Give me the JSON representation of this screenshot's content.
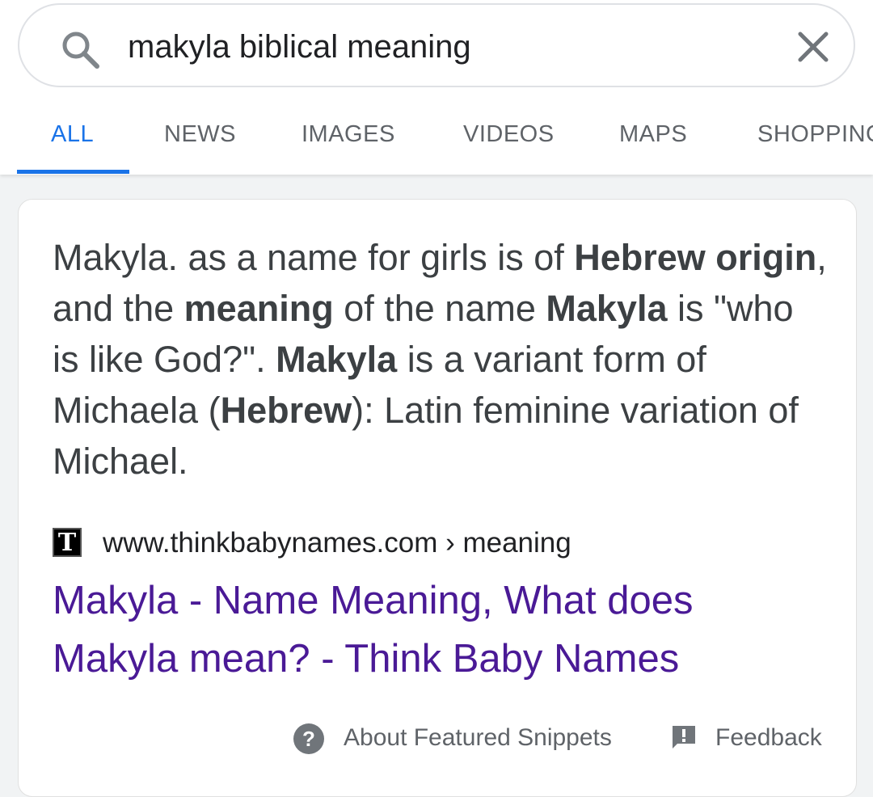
{
  "search": {
    "query": "makyla biblical meaning",
    "search_icon": "search-icon",
    "clear_icon": "close-icon"
  },
  "tabs": [
    {
      "label": "ALL",
      "active": true
    },
    {
      "label": "NEWS",
      "active": false
    },
    {
      "label": "IMAGES",
      "active": false
    },
    {
      "label": "VIDEOS",
      "active": false
    },
    {
      "label": "MAPS",
      "active": false
    },
    {
      "label": "SHOPPING",
      "active": false
    }
  ],
  "snippet": {
    "parts": [
      {
        "text": "Makyla. as a name for girls is of ",
        "bold": false
      },
      {
        "text": "Hebrew origin",
        "bold": true
      },
      {
        "text": ", and the ",
        "bold": false
      },
      {
        "text": "meaning",
        "bold": true
      },
      {
        "text": " of the name ",
        "bold": false
      },
      {
        "text": "Makyla",
        "bold": true
      },
      {
        "text": " is \"who is like God?\". ",
        "bold": false
      },
      {
        "text": "Makyla",
        "bold": true
      },
      {
        "text": " is a variant form of Michaela (",
        "bold": false
      },
      {
        "text": "Hebrew",
        "bold": true
      },
      {
        "text": "): Latin feminine variation of Michael.",
        "bold": false
      }
    ]
  },
  "source": {
    "favicon_letter": "T",
    "url": "www.thinkbabynames.com › meaning"
  },
  "result_title": "Makyla - Name Meaning, What does Makyla mean? - Think Baby Names",
  "footer": {
    "help_icon": "?",
    "about_label": "About Featured Snippets",
    "feedback_icon": "!",
    "feedback_label": "Feedback"
  },
  "colors": {
    "accent": "#1a73e8",
    "link_visited": "#4a1a96",
    "text": "#3c4043",
    "muted": "#5f6368"
  }
}
